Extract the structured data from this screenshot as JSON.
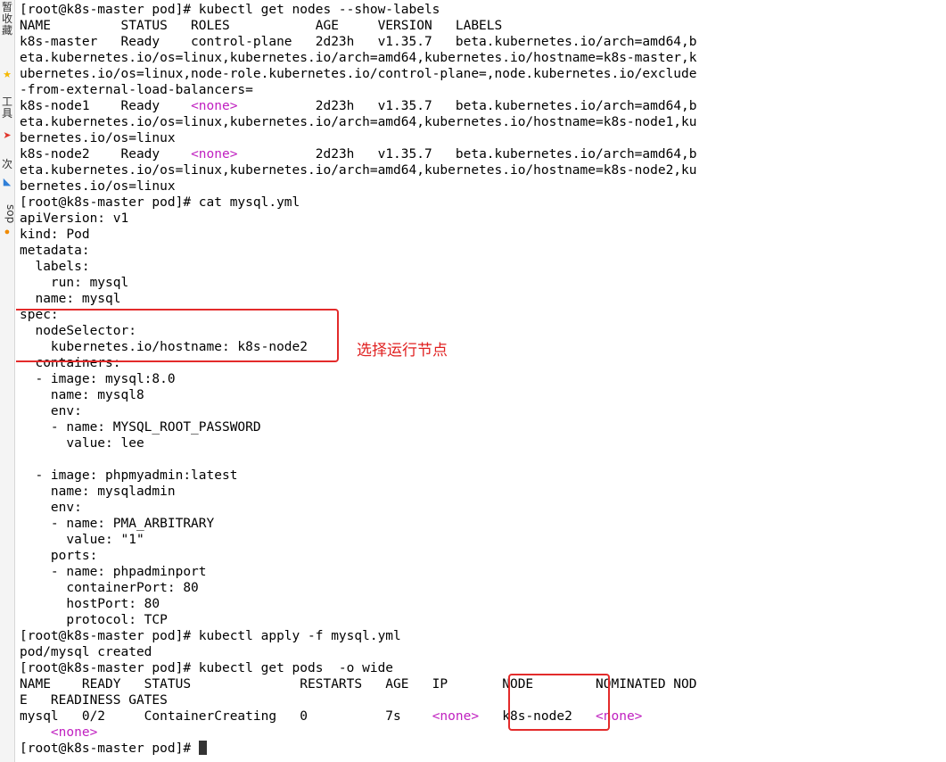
{
  "sidebar": {
    "texts": [
      "暂",
      "收",
      "藏",
      "工",
      "具",
      "次",
      "sop"
    ],
    "icons": [
      "star-icon",
      "red-arrow-icon",
      "blue-send-icon",
      "orange-circle-icon"
    ]
  },
  "terminal": {
    "lines": [
      [
        {
          "t": "[root@k8s-master pod]# kubectl get nodes --show-labels"
        }
      ],
      [
        {
          "t": "NAME         STATUS   ROLES           AGE     VERSION   LABELS"
        }
      ],
      [
        {
          "t": "k8s-master   Ready    control-plane   2d23h   v1.35.7   beta.kubernetes.io/arch=amd64,b"
        }
      ],
      [
        {
          "t": "eta.kubernetes.io/os=linux,kubernetes.io/arch=amd64,kubernetes.io/hostname=k8s-master,k"
        }
      ],
      [
        {
          "t": "ubernetes.io/os=linux,node-role.kubernetes.io/control-plane=,node.kubernetes.io/exclude"
        }
      ],
      [
        {
          "t": "-from-external-load-balancers="
        }
      ],
      [
        {
          "t": "k8s-node1    Ready    "
        },
        {
          "t": "<none>",
          "c": "none"
        },
        {
          "t": "          2d23h   v1.35.7   beta.kubernetes.io/arch=amd64,b"
        }
      ],
      [
        {
          "t": "eta.kubernetes.io/os=linux,kubernetes.io/arch=amd64,kubernetes.io/hostname=k8s-node1,ku"
        }
      ],
      [
        {
          "t": "bernetes.io/os=linux"
        }
      ],
      [
        {
          "t": "k8s-node2    Ready    "
        },
        {
          "t": "<none>",
          "c": "none"
        },
        {
          "t": "          2d23h   v1.35.7   beta.kubernetes.io/arch=amd64,b"
        }
      ],
      [
        {
          "t": "eta.kubernetes.io/os=linux,kubernetes.io/arch=amd64,kubernetes.io/hostname=k8s-node2,ku"
        }
      ],
      [
        {
          "t": "bernetes.io/os=linux"
        }
      ],
      [
        {
          "t": "[root@k8s-master pod]# cat mysql.yml"
        }
      ],
      [
        {
          "t": "apiVersion: v1"
        }
      ],
      [
        {
          "t": "kind: Pod"
        }
      ],
      [
        {
          "t": "metadata:"
        }
      ],
      [
        {
          "t": "  labels:"
        }
      ],
      [
        {
          "t": "    run: mysql"
        }
      ],
      [
        {
          "t": "  name: mysql"
        }
      ],
      [
        {
          "t": "spec:"
        }
      ],
      [
        {
          "t": "  nodeSelector:"
        }
      ],
      [
        {
          "t": "    kubernetes.io/hostname: k8s-node2"
        }
      ],
      [
        {
          "t": "  containers:"
        }
      ],
      [
        {
          "t": "  - image: mysql:8.0"
        }
      ],
      [
        {
          "t": "    name: mysql8"
        }
      ],
      [
        {
          "t": "    env:"
        }
      ],
      [
        {
          "t": "    - name: MYSQL_ROOT_PASSWORD"
        }
      ],
      [
        {
          "t": "      value: lee"
        }
      ],
      [
        {
          "t": ""
        }
      ],
      [
        {
          "t": "  - image: phpmyadmin:latest"
        }
      ],
      [
        {
          "t": "    name: mysqladmin"
        }
      ],
      [
        {
          "t": "    env:"
        }
      ],
      [
        {
          "t": "    - name: PMA_ARBITRARY"
        }
      ],
      [
        {
          "t": "      value: \"1\""
        }
      ],
      [
        {
          "t": "    ports:"
        }
      ],
      [
        {
          "t": "    - name: phpadminport"
        }
      ],
      [
        {
          "t": "      containerPort: 80"
        }
      ],
      [
        {
          "t": "      hostPort: 80"
        }
      ],
      [
        {
          "t": "      protocol: TCP"
        }
      ],
      [
        {
          "t": "[root@k8s-master pod]# kubectl apply -f mysql.yml"
        }
      ],
      [
        {
          "t": "pod/mysql created"
        }
      ],
      [
        {
          "t": "[root@k8s-master pod]# kubectl get pods  -o wide"
        }
      ],
      [
        {
          "t": "NAME    READY   STATUS              RESTARTS   AGE   IP       NODE        NOMINATED NOD"
        }
      ],
      [
        {
          "t": "E   READINESS GATES"
        }
      ],
      [
        {
          "t": "mysql   0/2     ContainerCreating   0          7s    "
        },
        {
          "t": "<none>",
          "c": "none"
        },
        {
          "t": "   k8s-node2   "
        },
        {
          "t": "<none>",
          "c": "none"
        }
      ],
      [
        {
          "t": "    "
        },
        {
          "t": "<none>",
          "c": "none"
        }
      ],
      [
        {
          "t": "[root@k8s-master pod]# "
        }
      ]
    ]
  },
  "annotations": {
    "label": "选择运行节点",
    "color": "#e32b2b"
  }
}
